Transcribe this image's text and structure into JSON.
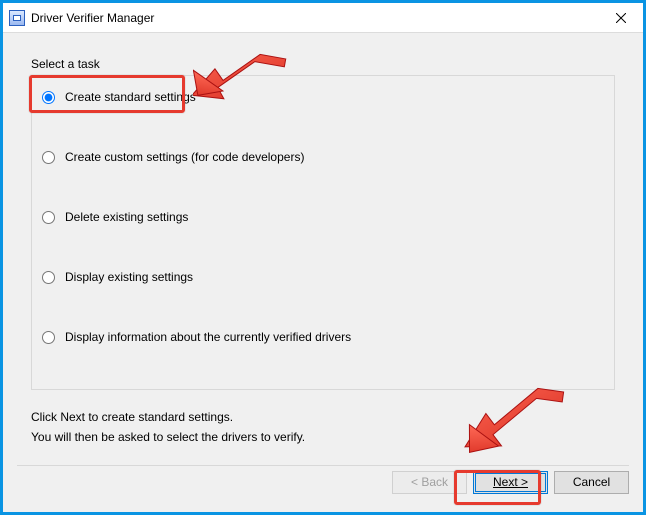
{
  "title": "Driver Verifier Manager",
  "prompt": "Select a task",
  "radios": [
    {
      "label": "Create standard settings",
      "checked": true
    },
    {
      "label": "Create custom settings (for code developers)",
      "checked": false
    },
    {
      "label": "Delete existing settings",
      "checked": false
    },
    {
      "label": "Display existing settings",
      "checked": false
    },
    {
      "label": "Display information about the currently verified drivers",
      "checked": false
    }
  ],
  "hint1": "Click Next to create standard settings.",
  "hint2": "You will then be asked to select the drivers to verify.",
  "buttons": {
    "back": "< Back",
    "next": "Next >",
    "cancel": "Cancel"
  },
  "annotation_color": "#e63a2e"
}
